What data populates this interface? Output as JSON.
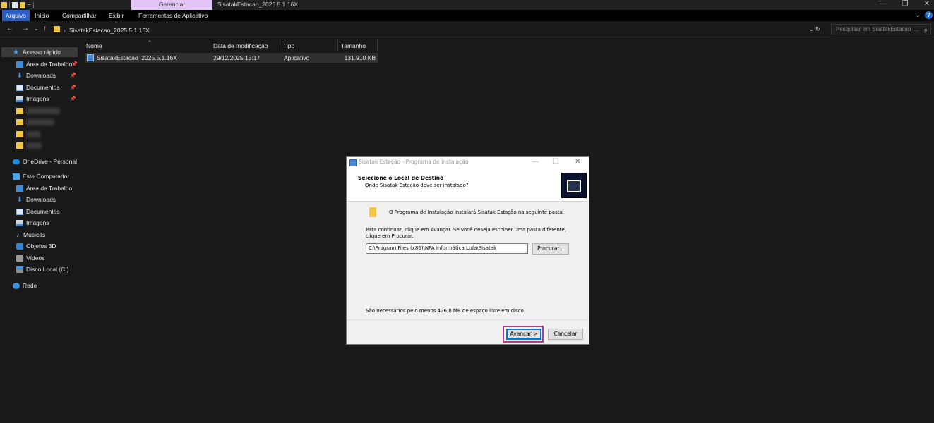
{
  "window": {
    "title": "SisatakEstacao_2025.5.1.16X",
    "context_tab": "Gerenciar",
    "controls": {
      "minimize": "—",
      "restore": "❐",
      "close": "✕"
    }
  },
  "ribbon": {
    "tabs": [
      "Arquivo",
      "Início",
      "Compartilhar",
      "Exibir",
      "Ferramentas de Aplicativo"
    ],
    "active_tab": "Arquivo",
    "expand_glyph": "⌄",
    "help": "?"
  },
  "address_bar": {
    "back": "←",
    "forward": "→",
    "recent": "⌄",
    "up": "↑",
    "separator": "›",
    "path": "SisatakEstacao_2025.5.1.16X",
    "refresh": "⌄ ↻",
    "search_placeholder": "Pesquisar em SisatakEstacao_...",
    "search_icon": "⌕"
  },
  "sidebar": {
    "quick_access": {
      "label": "Acesso rápido",
      "icon": "star-icon"
    },
    "pinned": [
      {
        "label": "Área de Trabalho",
        "icon": "desktop-icon"
      },
      {
        "label": "Downloads",
        "icon": "download-icon"
      },
      {
        "label": "Documentos",
        "icon": "document-icon"
      },
      {
        "label": "Imagens",
        "icon": "pictures-icon"
      }
    ],
    "pin_glyph": "📌",
    "onedrive": "OneDrive - Personal",
    "this_pc": {
      "label": "Este Computador",
      "items": [
        "Área de Trabalho",
        "Downloads",
        "Documentos",
        "Imagens",
        "Músicas",
        "Objetos 3D",
        "Vídeos",
        "Disco Local (C:)"
      ]
    },
    "network": "Rede"
  },
  "file_list": {
    "columns": [
      "Nome",
      "Data de modificação",
      "Tipo",
      "Tamanho"
    ],
    "sort_glyph": "^",
    "rows": [
      {
        "name": "SisatakEstacao_2025.5.1.16X",
        "modified": "29/12/2025 15:17",
        "type": "Aplicativo",
        "size": "131.910 KB"
      }
    ]
  },
  "installer": {
    "title": "Sisatak Estação - Programa de Instalação",
    "minimize": "—",
    "maximize": "☐",
    "close": "✕",
    "heading": "Selecione o Local de Destino",
    "subheading": "Onde Sisatak Estação deve ser instalado?",
    "info": "O Programa de Instalação instalará Sisatak Estação na seguinte pasta.",
    "instructions": "Para continuar, clique em Avançar. Se você deseja escolher uma pasta diferente, clique em Procurar.",
    "path": "C:\\Program Files (x86)\\NPA Informática Ltda\\Sisatak",
    "browse_button": "Procurar...",
    "space_note": "São necessários pelo menos 426,8 MB de espaço livre em disco.",
    "next_button": "Avançar >",
    "cancel_button": "Cancelar"
  },
  "colors": {
    "explorer_bg": "#191919",
    "ribbon_active": "#2a5ec4",
    "context_tab": "#e2c4f7",
    "highlight_box": "#b23a8a",
    "focus_button": "#0078d7"
  }
}
